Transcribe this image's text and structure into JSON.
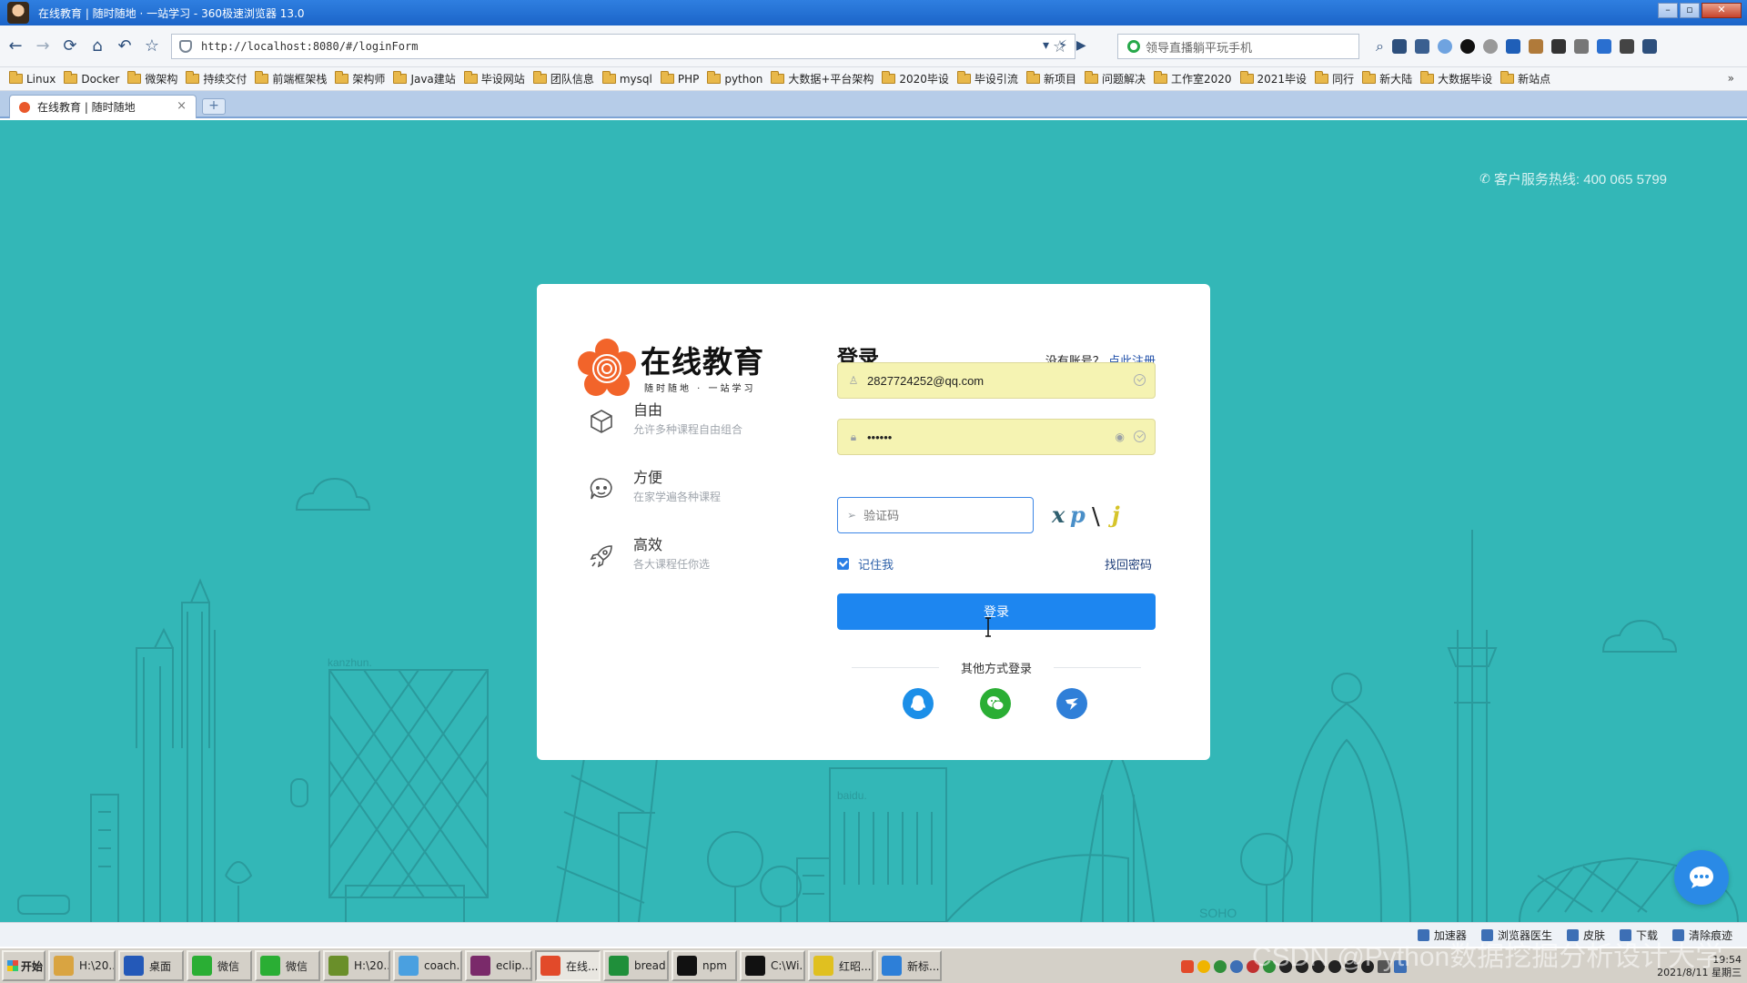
{
  "browser": {
    "window_title": "在线教育 | 随时随地 · 一站学习 - 360极速浏览器 13.0",
    "url": "http://localhost:8080/#/loginForm",
    "search_placeholder": "领导直播躺平玩手机",
    "bookmarks": [
      "Linux",
      "Docker",
      "微架构",
      "持续交付",
      "前端框架栈",
      "架构师",
      "Java建站",
      "毕设网站",
      "团队信息",
      "mysql",
      "PHP",
      "python",
      "大数据+平台架构",
      "2020毕设",
      "毕设引流",
      "新项目",
      "问题解决",
      "工作室2020",
      "2021毕设",
      "同行",
      "新大陆",
      "大数据毕设",
      "新站点"
    ],
    "bookmarks_more": "»",
    "tab_title": "在线教育 | 随时随地",
    "tab_close": "×",
    "newtab": "+"
  },
  "page": {
    "hotline": "客户服务热线: 400 065 5799",
    "brand_name": "在线教育",
    "brand_slogan": "随时随地 · 一站学习",
    "features": [
      {
        "title": "自由",
        "desc": "允许多种课程自由组合",
        "icon": "cube-icon"
      },
      {
        "title": "方便",
        "desc": "在家学遍各种课程",
        "icon": "chat-face-icon"
      },
      {
        "title": "高效",
        "desc": "各大课程任你选",
        "icon": "rocket-icon"
      }
    ],
    "login_title": "登录",
    "register_prompt": "没有账号？",
    "register_link": "点此注册",
    "username_value": "2827724252@qq.com",
    "password_value": "••••••",
    "captcha_placeholder": "验证码",
    "captcha_text": [
      "x",
      "p",
      "\\",
      "j"
    ],
    "remember_label": "记住我",
    "forgot_link": "找回密码",
    "login_button": "登录",
    "other_login": "其他方式登录",
    "social": [
      "qq-icon",
      "wechat-icon",
      "weibo-icon"
    ],
    "skyline_labels": {
      "kanzhun": "kanzhun.",
      "baidu": "baidu.",
      "soho": "SOHO"
    }
  },
  "statusbar": [
    "加速器",
    "浏览器医生",
    "皮肤",
    "下载",
    "清除痕迹"
  ],
  "taskbar": {
    "start": "开始",
    "tasks": [
      "H:\\20...",
      "桌面",
      "微信",
      "微信",
      "H:\\20...",
      "coach...",
      "eclip...",
      "在线...",
      "bread...",
      "npm",
      "C:\\Wi...",
      "红昭...",
      "新标..."
    ],
    "time": "19:54",
    "date": "2021/8/11 星期三"
  },
  "watermark": "CSDN @Python数据挖掘分析设计大学",
  "colors": {
    "page_bg": "#33b7b7",
    "primary_button": "#1d86f0",
    "autofill": "#f5f3b2"
  }
}
